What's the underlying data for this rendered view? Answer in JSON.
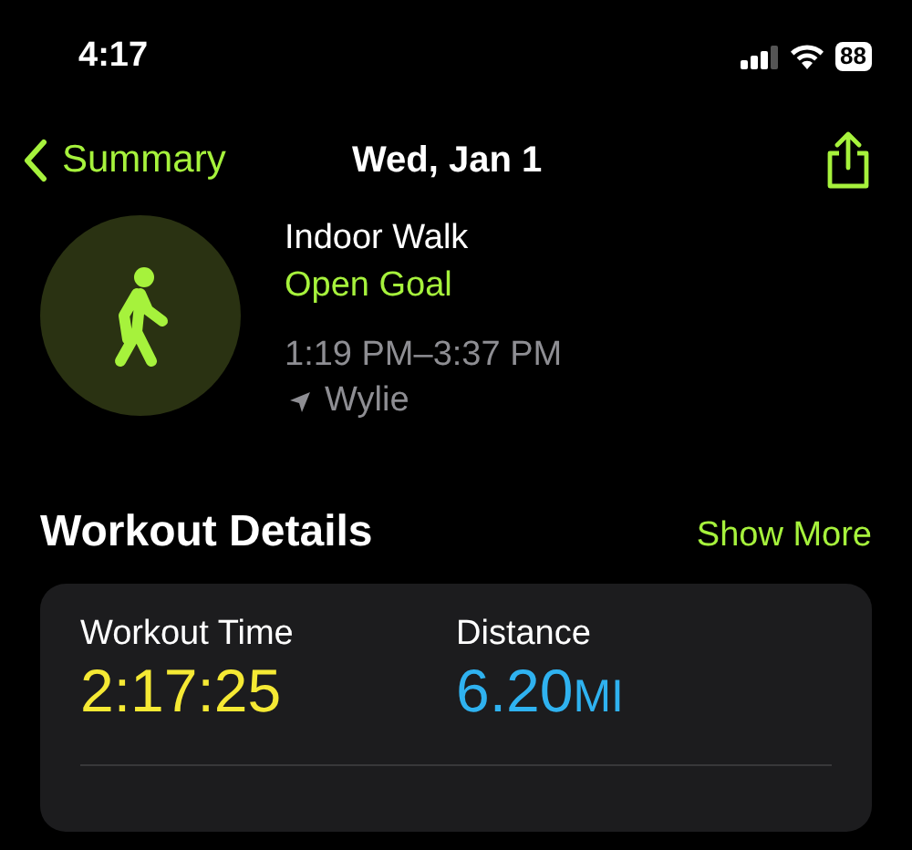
{
  "status_bar": {
    "time": "4:17",
    "battery": "88"
  },
  "nav": {
    "back": "Summary",
    "title": "Wed, Jan 1"
  },
  "workout": {
    "name": "Indoor Walk",
    "goal": "Open Goal",
    "time_range": "1:19 PM–3:37 PM",
    "location": "Wylie"
  },
  "section": {
    "title": "Workout Details",
    "action": "Show More"
  },
  "metrics": [
    {
      "label": "Workout Time",
      "value": "2:17:25",
      "color": "#f5e934"
    },
    {
      "label": "Distance",
      "value": "6.20",
      "unit": "MI",
      "color": "#2fb2f0"
    }
  ]
}
